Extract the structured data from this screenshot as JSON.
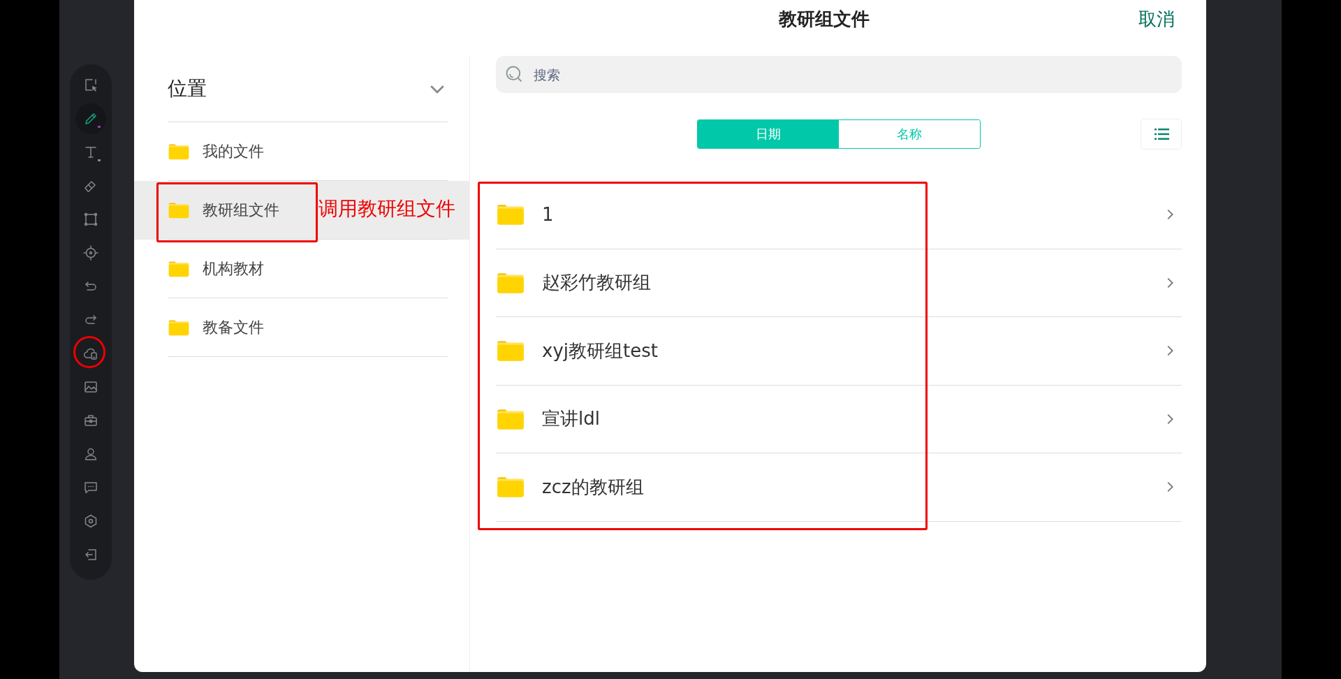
{
  "toolbar": {
    "tools": [
      {
        "selected": false
      },
      {
        "selected": true
      },
      {
        "selected": false
      },
      {
        "selected": false
      },
      {
        "selected": false
      },
      {
        "selected": false
      },
      {
        "selected": false
      },
      {
        "selected": false
      },
      {
        "selected": false
      },
      {
        "selected": false
      },
      {
        "selected": false
      },
      {
        "selected": false
      },
      {
        "selected": false
      },
      {
        "selected": false
      },
      {
        "selected": false
      }
    ]
  },
  "dialog": {
    "title": "教研组文件",
    "cancel": "取消"
  },
  "sidebar": {
    "heading": "位置",
    "items": [
      {
        "label": "我的文件",
        "selected": false
      },
      {
        "label": "教研组文件",
        "selected": true
      },
      {
        "label": "机构教材",
        "selected": false
      },
      {
        "label": "教备文件",
        "selected": false
      }
    ]
  },
  "search": {
    "placeholder": "搜索"
  },
  "sort_tabs": [
    {
      "label": "日期",
      "selected": true
    },
    {
      "label": "名称",
      "selected": false
    }
  ],
  "files": [
    {
      "name": "1"
    },
    {
      "name": "赵彩竹教研组"
    },
    {
      "name": "xyj教研组test"
    },
    {
      "name": "宣讲ldl"
    },
    {
      "name": "zcz的教研组"
    }
  ],
  "annotations": [
    {
      "text": "调用教研组文件"
    }
  ]
}
